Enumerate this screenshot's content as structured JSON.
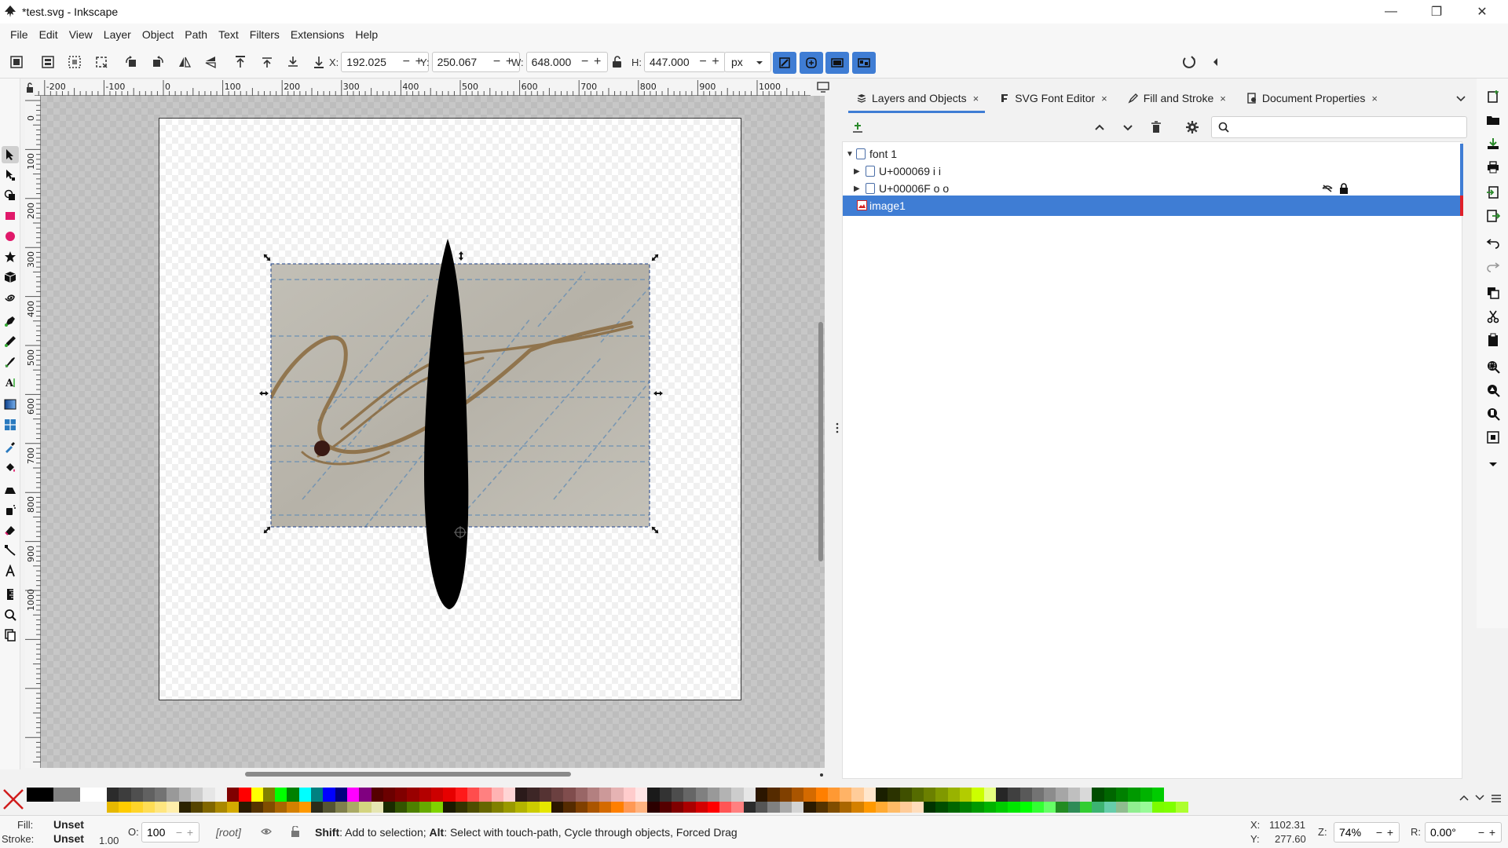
{
  "window": {
    "title": "*test.svg - Inkscape",
    "minimize": "—",
    "maximize": "❐",
    "close": "✕"
  },
  "menubar": [
    "File",
    "Edit",
    "View",
    "Layer",
    "Object",
    "Path",
    "Text",
    "Filters",
    "Extensions",
    "Help"
  ],
  "controls": {
    "x_label": "X:",
    "x_value": "192.025",
    "y_label": "Y:",
    "y_value": "250.067",
    "w_label": "W:",
    "w_value": "648.000",
    "h_label": "H:",
    "h_value": "447.000",
    "unit": "px",
    "minus": "−",
    "plus": "+"
  },
  "rulers": {
    "horizontal": [
      "-200",
      "-100",
      "0",
      "100",
      "200",
      "300",
      "400",
      "500",
      "600",
      "700",
      "800",
      "900",
      "1000"
    ],
    "vertical": [
      "0",
      "100",
      "200",
      "300",
      "400",
      "500",
      "600",
      "700",
      "800",
      "900",
      "1000"
    ]
  },
  "dock": {
    "tabs": [
      {
        "label": "Layers and Objects",
        "icon": "layers-icon",
        "active": true
      },
      {
        "label": "SVG Font Editor",
        "icon": "font-editor-icon",
        "active": false
      },
      {
        "label": "Fill and Stroke",
        "icon": "fill-stroke-icon",
        "active": false
      },
      {
        "label": "Document Properties",
        "icon": "document-icon",
        "active": false
      }
    ],
    "tab_close": "×",
    "search_placeholder": "",
    "tree": [
      {
        "label": "font 1",
        "level": 0,
        "expanded": true,
        "selected": false
      },
      {
        "label": "U+000069 i i",
        "level": 1,
        "expanded": false,
        "selected": false,
        "hidden": false,
        "locked": false
      },
      {
        "label": "U+00006F o o",
        "level": 1,
        "expanded": false,
        "selected": false,
        "hidden": true,
        "locked": true
      },
      {
        "label": "image1",
        "level": 0,
        "expanded": false,
        "selected": true
      }
    ]
  },
  "status": {
    "fill_label": "Fill:",
    "fill_value": "Unset",
    "stroke_label": "Stroke:",
    "stroke_value": "Unset",
    "stroke_width": "1.00",
    "opacity_label": "O:",
    "opacity_value": "100",
    "layer": "[root]",
    "message_bold1": "Shift",
    "message_1": ": Add to selection; ",
    "message_bold2": "Alt",
    "message_2": ": Select with touch-path, Cycle through objects, Forced Drag",
    "cursor_x_label": "X:",
    "cursor_x": "1102.31",
    "cursor_y_label": "Y:",
    "cursor_y": "277.60",
    "zoom_label": "Z:",
    "zoom_value": "74%",
    "rotate_label": "R:",
    "rotate_value": "0.00°"
  },
  "colors": {
    "accent": "#3f7dd4",
    "selected_row": "#3f7dd4",
    "layer_color_marker": "#e0202a",
    "palette_top": [
      "#000000",
      "#808080",
      "#ffffff",
      "#2b2b2b",
      "#3d3d3d",
      "#4f4f4f",
      "#616161",
      "#737373",
      "#999999",
      "#b3b3b3",
      "#cccccc",
      "#e6e6e6",
      "#f2f2f2",
      "#800000",
      "#ff0000",
      "#ffff00",
      "#808000",
      "#00ff00",
      "#008000",
      "#00ffff",
      "#008080",
      "#0000ff",
      "#000080",
      "#ff00ff",
      "#800080",
      "#550000",
      "#6b0000",
      "#800000",
      "#990000",
      "#b30000",
      "#cc0000",
      "#e60000",
      "#ff1a1a",
      "#ff4d4d",
      "#ff8080",
      "#ffb3b3",
      "#ffd5d5",
      "#2b1a1a",
      "#3d2626",
      "#553333",
      "#6b4040",
      "#804d4d",
      "#996666",
      "#b38080",
      "#cc9999",
      "#e6b3b3",
      "#ffcccc",
      "#ffe6e6",
      "#1a1a1a",
      "#333333",
      "#4d4d4d",
      "#666666",
      "#808080",
      "#999999",
      "#b3b3b3",
      "#cccccc",
      "#e6e6e6",
      "#2b1600",
      "#552b00",
      "#804000",
      "#aa5500",
      "#d46a00",
      "#ff7f00",
      "#ff9933",
      "#ffb366",
      "#ffcc99",
      "#ffe6cc",
      "#1a1f00",
      "#2b3300",
      "#405000",
      "#556b00",
      "#6b8000",
      "#809900",
      "#99b300",
      "#b3cc00",
      "#ccff00",
      "#e6ff80",
      "#262626",
      "#404040",
      "#595959",
      "#737373",
      "#8c8c8c",
      "#a6a6a6",
      "#bfbfbf",
      "#d9d9d9",
      "#004d00",
      "#006600",
      "#008000",
      "#009900",
      "#00b300",
      "#00cc00"
    ],
    "palette_bottom": [
      "#e6b800",
      "#ffcc00",
      "#ffd42a",
      "#ffdd55",
      "#ffe680",
      "#ffeeaa",
      "#2b2200",
      "#554400",
      "#806600",
      "#aa8800",
      "#d4aa00",
      "#2b1a00",
      "#553300",
      "#804d00",
      "#aa6600",
      "#d48000",
      "#ff9900",
      "#2b2b1a",
      "#555533",
      "#80804d",
      "#aaaa66",
      "#d4d480",
      "#e6e6b3",
      "#1a2b00",
      "#335500",
      "#4d8000",
      "#66aa00",
      "#80d400",
      "#1a1a00",
      "#333300",
      "#4d4d00",
      "#666600",
      "#808000",
      "#999900",
      "#b3b300",
      "#cccc00",
      "#e6e600",
      "#2b1600",
      "#552b00",
      "#804000",
      "#aa5500",
      "#d46a00",
      "#ff7f00",
      "#ff9955",
      "#ffb380",
      "#2b0000",
      "#550000",
      "#800000",
      "#aa0000",
      "#d40000",
      "#ff0000",
      "#ff5555",
      "#ff8080",
      "#2b2b2b",
      "#555555",
      "#808080",
      "#aaaaaa",
      "#d4d4d4",
      "#2b1a00",
      "#553300",
      "#804d00",
      "#aa6600",
      "#d48000",
      "#ff9900",
      "#ffaa33",
      "#ffbb66",
      "#ffcc99",
      "#ffddbb",
      "#003300",
      "#004d00",
      "#006600",
      "#008000",
      "#009900",
      "#00b300",
      "#00cc00",
      "#00e600",
      "#00ff00",
      "#33ff33",
      "#66ff66",
      "#228b22",
      "#2e8b57",
      "#32cd32",
      "#3cb371",
      "#66cdaa",
      "#8fbc8f",
      "#90ee90",
      "#98fb98",
      "#7cfc00",
      "#7fff00",
      "#adff2f"
    ]
  },
  "icons": {
    "toolbox": [
      "selector-icon",
      "node-icon",
      "shape-builder-icon",
      "rectangle-icon",
      "ellipse-icon",
      "star-icon",
      "box3d-icon",
      "spiral-icon",
      "pen-icon",
      "pencil-icon",
      "calligraphy-icon",
      "text-icon",
      "gradient-icon",
      "mesh-icon",
      "dropper-icon",
      "paint-bucket-icon",
      "tweak-icon",
      "spray-icon",
      "eraser-icon",
      "connector-icon",
      "lpe-icon",
      "measure-icon",
      "zoom-icon",
      "pages-icon"
    ],
    "right_commands": [
      "new-document-icon",
      "open-icon",
      "save-icon",
      "print-icon",
      "import-icon",
      "export-icon",
      "undo-icon",
      "redo-icon",
      "copy-icon",
      "cut-icon",
      "paste-icon",
      "zoom-selection-icon",
      "zoom-drawing-icon",
      "zoom-page-icon",
      "zoom-center-icon",
      "more-icon"
    ]
  }
}
